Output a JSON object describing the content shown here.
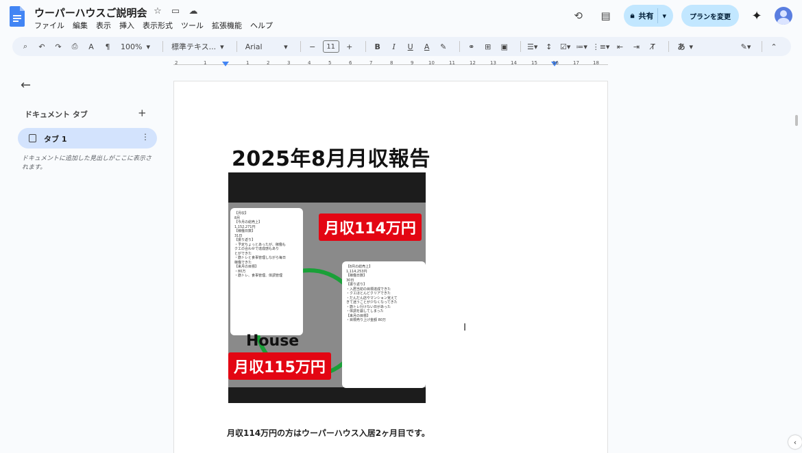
{
  "header": {
    "title": "ウーパーハウスご説明会",
    "menu": [
      "ファイル",
      "編集",
      "表示",
      "挿入",
      "表示形式",
      "ツール",
      "拡張機能",
      "ヘルプ"
    ],
    "share_label": "共有",
    "plan_label": "プランを変更"
  },
  "toolbar": {
    "zoom": "100%",
    "style": "標準テキス...",
    "font": "Arial",
    "font_size": "11",
    "ime": "あ"
  },
  "ruler": {
    "numbers": [
      "2",
      "1",
      "1",
      "2",
      "3",
      "4",
      "5",
      "6",
      "7",
      "8",
      "9",
      "10",
      "11",
      "12",
      "13",
      "14",
      "15",
      "16",
      "17",
      "18"
    ]
  },
  "sidebar": {
    "section_title": "ドキュメント タブ",
    "tab_label": "タブ 1",
    "hint": "ドキュメントに追加した見出しがここに表示されます。"
  },
  "document": {
    "heading": "2025年8月月収報告",
    "banner_top": "月収114万円",
    "banner_bottom": "月収115万円",
    "house_text": "House",
    "note_left": "【月収】\n8月\n【今月の総売上】\n1,152,271円\n【稼働日数】\n31日\n【振り返り】\n・予定ちょっとあったが、稼働も\nクエの合わせで達成感もあり\nとができた\n・筋トレと食事管理しながら毎日\n稼働できた\n【来月の目標】\n・80万\n・筋トレ、食事管理、体調管理",
    "note_right": "【8月の総売上】\n1,114,253円\n【稼働日数】\n30日\n【振り返り】\n・入居当初の目標達成できた\n・クエほとんどクリアできた\n・だんだん店やマンション覚えて\nきて迷うことが少なくなってきた\n・筋トレ行けない日があった\n・体調を崩してしまった\n【来月の目標】\n・目標売り上げ金額 80万",
    "caption": "月収114万円の方はウーパーハウス入居2ヶ月目です。"
  }
}
